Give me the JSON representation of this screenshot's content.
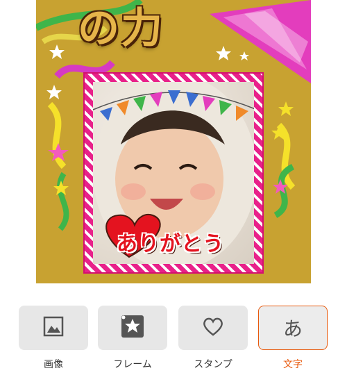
{
  "canvas": {
    "title": "の力",
    "sticker_text": "ありがとう",
    "colors": {
      "background": "#c8a231",
      "frame": "#e8218a",
      "sticker_red": "#e4131f"
    }
  },
  "toolbar": {
    "items": [
      {
        "label": "画像",
        "icon": "image-icon",
        "active": false
      },
      {
        "label": "フレーム",
        "icon": "frame-icon",
        "active": false
      },
      {
        "label": "スタンプ",
        "icon": "heart-icon",
        "active": false
      },
      {
        "label": "文字",
        "icon": "text-icon",
        "glyph": "あ",
        "active": true
      }
    ],
    "accent": "#e8590c"
  }
}
